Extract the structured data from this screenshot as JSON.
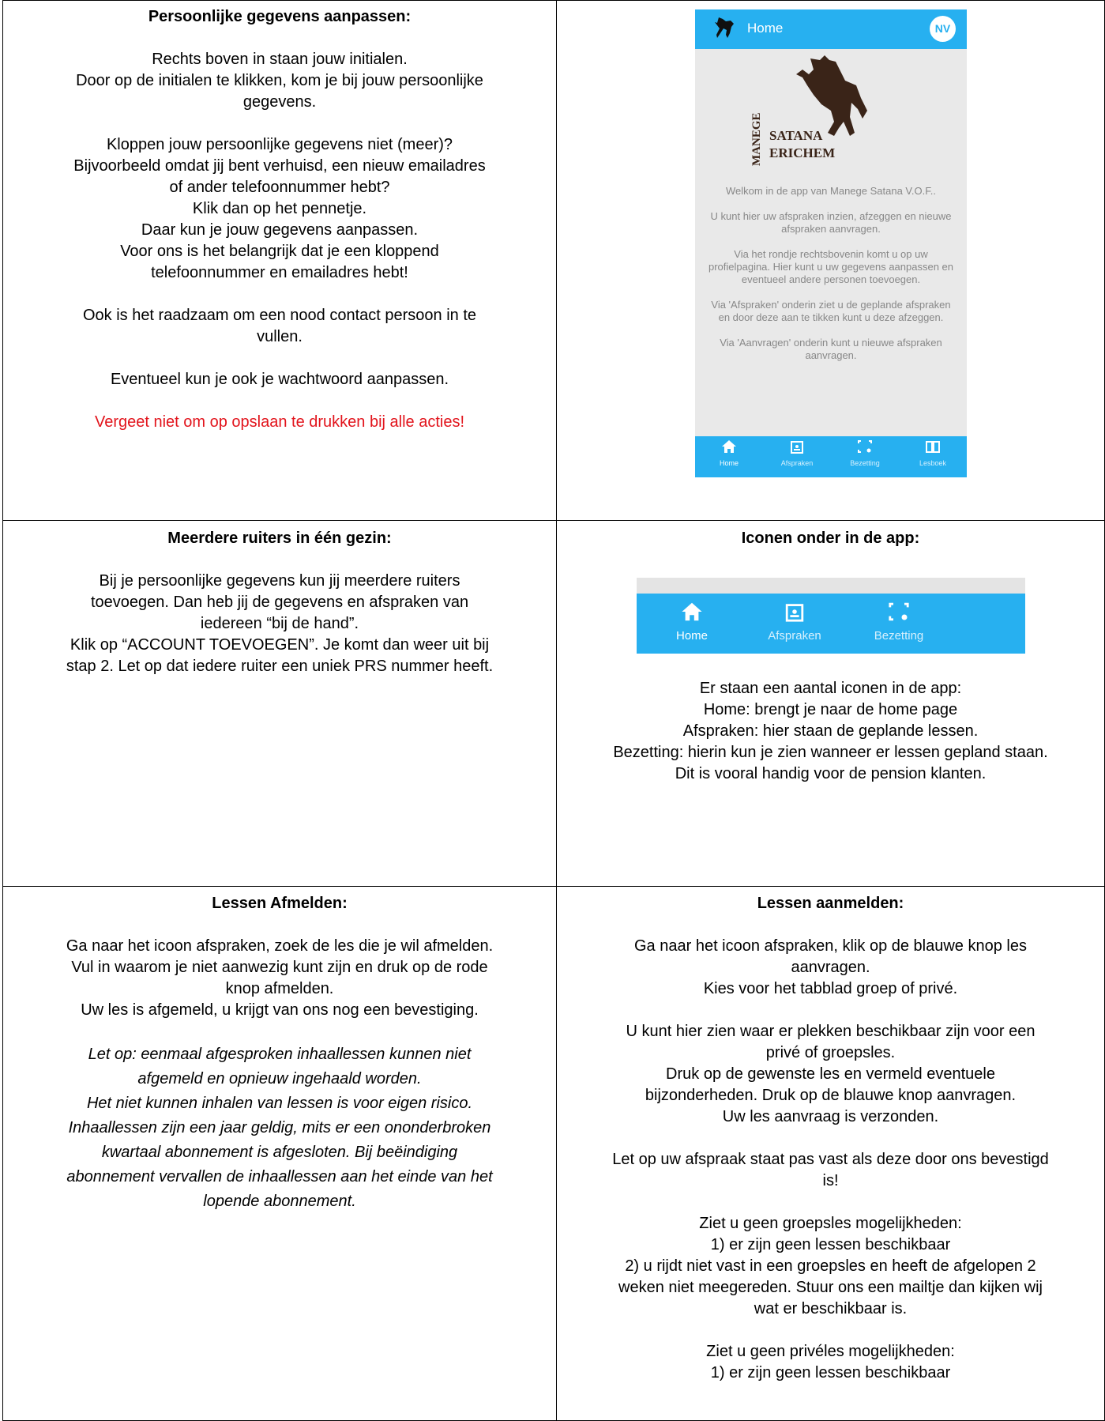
{
  "cell1": {
    "title": "Persoonlijke gegevens aanpassen:",
    "lines": [
      "Rechts boven in staan jouw initialen.",
      "Door op de initialen te klikken, kom je bij jouw persoonlijke",
      "gegevens.",
      "",
      "Kloppen jouw persoonlijke gegevens niet (meer)?",
      "Bijvoorbeeld omdat jij bent verhuisd, een nieuw emailadres",
      "of ander telefoonnummer hebt?",
      "Klik dan op het pennetje.",
      "Daar kun je jouw gegevens aanpassen.",
      "Voor ons is het belangrijk dat je een kloppend",
      "telefoonnummer en emailadres hebt!",
      "",
      "Ook is het raadzaam om een nood contact persoon in te",
      "vullen.",
      "",
      "Eventueel kun je ook je wachtwoord aanpassen.",
      ""
    ],
    "warning": "Vergeet niet om op opslaan te drukken bij alle acties!"
  },
  "phone": {
    "title": "Home",
    "avatar": "NV",
    "logo_vertical": "MANEGE",
    "logo_name": "SATANA",
    "logo_place": "ERICHEM",
    "paragraphs": [
      "Welkom in de app van Manege Satana V.O.F..",
      "U kunt hier uw afspraken inzien, afzeggen en nieuwe afspraken aanvragen.",
      "Via het rondje rechtsbovenin komt u op uw profielpagina. Hier kunt u uw gegevens aanpassen en eventueel andere personen toevoegen.",
      "Via 'Afspraken' onderin ziet u de geplande afspraken en door deze aan te tikken kunt u deze afzeggen.",
      "Via 'Aanvragen' onderin kunt u nieuwe afspraken aanvragen."
    ],
    "nav": [
      "Home",
      "Afspraken",
      "Bezetting",
      "Lesboek"
    ]
  },
  "cell3": {
    "title": "Meerdere ruiters in één gezin:",
    "lines": [
      "Bij je persoonlijke gegevens kun jij meerdere ruiters",
      "toevoegen. Dan heb jij de gegevens en afspraken van",
      "iedereen “bij de hand”.",
      "Klik op “ACCOUNT TOEVOEGEN”. Je komt dan weer uit bij",
      "stap 2. Let op dat iedere ruiter een uniek PRS nummer heeft."
    ]
  },
  "cell4": {
    "title": "Iconen onder in de app:",
    "nav": [
      "Home",
      "Afspraken",
      "Bezetting"
    ],
    "lines": [
      "Er staan een aantal iconen in de app:",
      "Home: brengt je naar de home page",
      "Afspraken: hier staan de geplande lessen.",
      "Bezetting: hierin kun je zien wanneer er lessen gepland staan.",
      "Dit is vooral handig voor de pension klanten."
    ]
  },
  "cell5": {
    "title": "Lessen Afmelden:",
    "lines": [
      "Ga naar het icoon afspraken, zoek de les die je wil afmelden.",
      "Vul in waarom je niet aanwezig kunt zijn en druk op de rode",
      "knop afmelden.",
      "Uw les is afgemeld, u krijgt van ons nog een bevestiging."
    ],
    "italic_lines": [
      "Let op: eenmaal afgesproken inhaallessen kunnen niet",
      "afgemeld en opnieuw ingehaald worden.",
      "Het niet kunnen inhalen van lessen is voor eigen risico.",
      "Inhaallessen zijn een jaar geldig, mits er een ononderbroken",
      "kwartaal abonnement is afgesloten. Bij beëindiging",
      "abonnement vervallen de inhaallessen aan het einde van het",
      "lopende abonnement."
    ]
  },
  "cell6": {
    "title": "Lessen aanmelden:",
    "lines": [
      "Ga naar het icoon afspraken, klik op de blauwe knop les",
      "aanvragen.",
      "Kies voor het tabblad groep of privé.",
      "",
      "U kunt hier zien waar er plekken beschikbaar zijn voor een",
      "privé of groepsles.",
      "Druk op de gewenste les en vermeld eventuele",
      "bijzonderheden. Druk op de blauwe knop aanvragen.",
      "Uw les aanvraag is verzonden.",
      "",
      "Let op uw afspraak staat pas vast als deze door ons bevestigd",
      "is!",
      "",
      "Ziet u geen groepsles mogelijkheden:",
      "1) er zijn geen lessen beschikbaar",
      "2) u rijdt niet vast in een groepsles en heeft de afgelopen 2",
      "weken niet meegereden. Stuur ons een mailtje dan kijken wij",
      "wat er beschikbaar is.",
      "",
      "Ziet u geen privéles mogelijkheden:",
      "1) er zijn geen lessen beschikbaar"
    ]
  }
}
